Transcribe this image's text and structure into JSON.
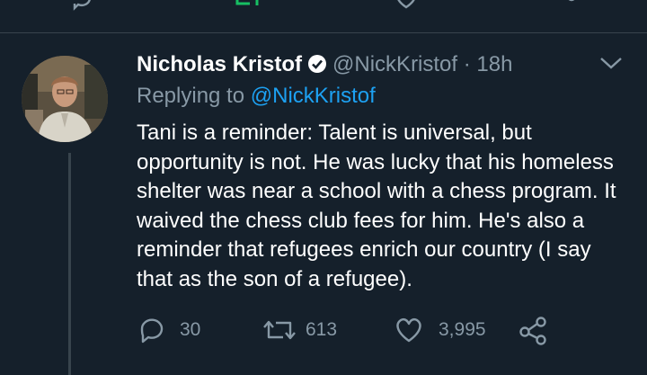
{
  "tweet": {
    "author_name": "Nicholas Kristof",
    "author_handle": "@NickKristof",
    "separator": "·",
    "time": "18h",
    "replying_prefix": "Replying to",
    "replying_to": "@NickKristof",
    "text": "Tani is a reminder: Talent is universal, but opportunity is not. He was lucky that his homeless shelter was near a school with a chess program. It waived the chess club fees for him. He's also a reminder that refugees enrich our country (I say that as the son of a refugee).",
    "replies": "30",
    "retweets": "613",
    "likes": "3,995"
  },
  "icons": {
    "verified": "verified-badge-icon",
    "more": "chevron-down-icon",
    "reply": "reply-icon",
    "retweet": "retweet-icon",
    "like": "heart-icon",
    "share": "share-icon"
  },
  "colors": {
    "background": "#15202b",
    "secondary_text": "#8899a6",
    "link": "#1da1f2",
    "divider": "#38444d",
    "retweet_active": "#17bf63"
  }
}
